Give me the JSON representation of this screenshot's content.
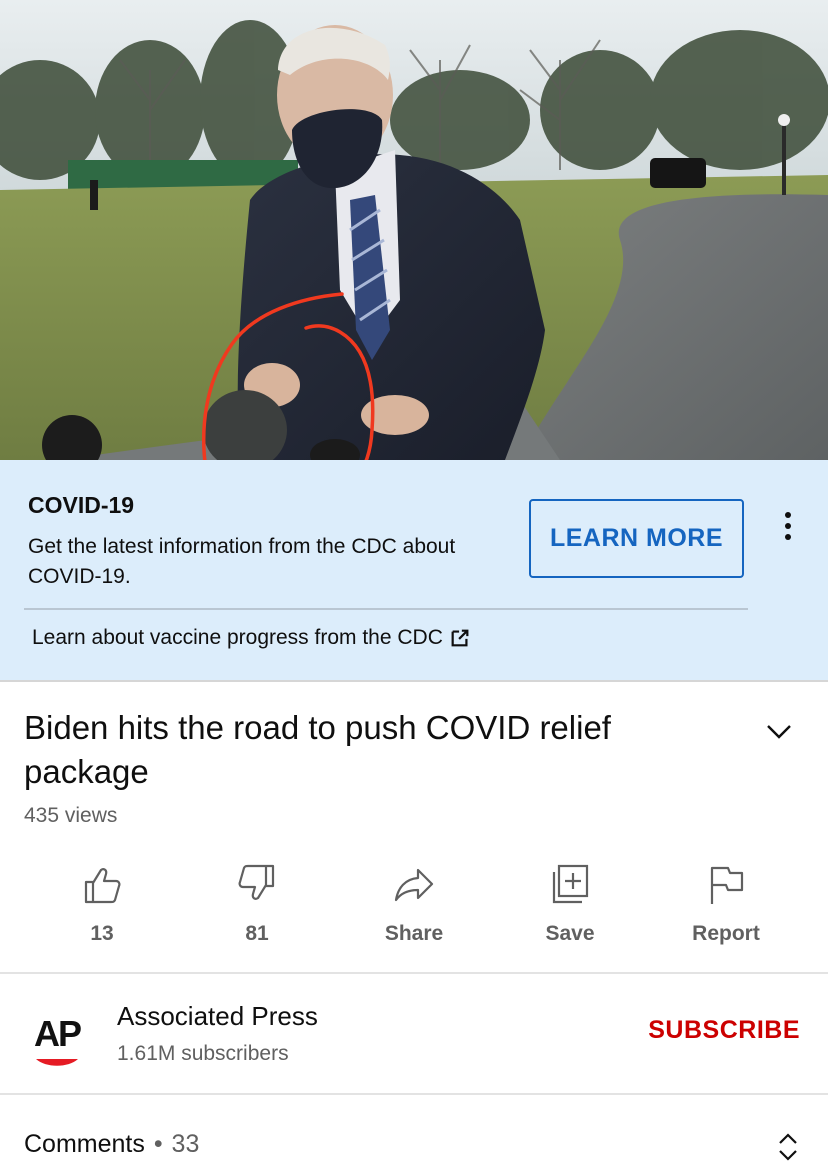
{
  "video": {
    "description_icon": "video-frame"
  },
  "info_panel": {
    "title": "COVID-19",
    "description": "Get the latest information from the CDC about COVID-19.",
    "button_label": "LEARN MORE",
    "link_text": "Learn about vaccine progress from the CDC",
    "background": "#dcedfb",
    "accent": "#1565c0"
  },
  "video_info": {
    "title": "Biden hits the road to push COVID relief package",
    "views": "435 views"
  },
  "actions": [
    {
      "icon": "thumbs-up-icon",
      "label": "13"
    },
    {
      "icon": "thumbs-down-icon",
      "label": "81"
    },
    {
      "icon": "share-icon",
      "label": "Share"
    },
    {
      "icon": "save-icon",
      "label": "Save"
    },
    {
      "icon": "flag-icon",
      "label": "Report"
    }
  ],
  "channel": {
    "name": "Associated Press",
    "subscribers": "1.61M subscribers",
    "logo_text": "AP",
    "subscribe_label": "SUBSCRIBE",
    "subscribe_color": "#cc0000"
  },
  "comments": {
    "label": "Comments",
    "separator": "•",
    "count": "33"
  }
}
